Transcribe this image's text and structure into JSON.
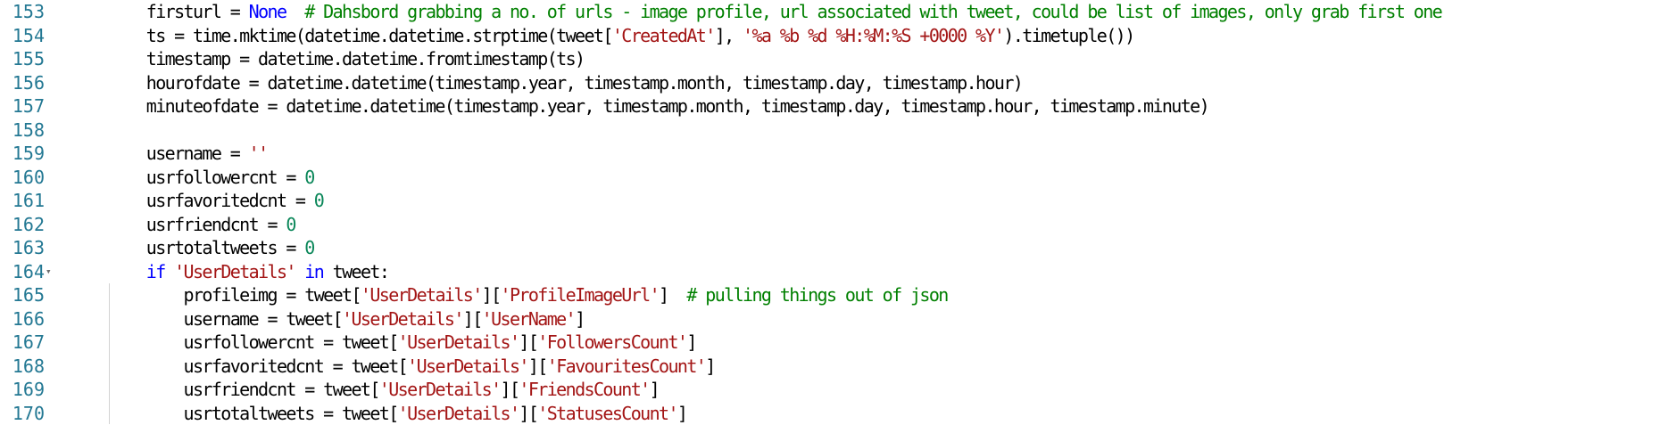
{
  "lines": [
    {
      "num": "153",
      "tokens": [
        {
          "t": "    firsturl = ",
          "c": ""
        },
        {
          "t": "None",
          "c": "kw"
        },
        {
          "t": "  # Dahsbord grabbing a no. of urls - image profile, url associated with tweet, could be list of images, only grab first one",
          "c": "com"
        }
      ]
    },
    {
      "num": "154",
      "tokens": [
        {
          "t": "    ts = time.mktime(datetime.datetime.strptime(tweet[",
          "c": ""
        },
        {
          "t": "'CreatedAt'",
          "c": "str"
        },
        {
          "t": "], ",
          "c": ""
        },
        {
          "t": "'%a %b %d %H:%M:%S +0000 %Y'",
          "c": "str"
        },
        {
          "t": ").timetuple())",
          "c": ""
        }
      ]
    },
    {
      "num": "155",
      "tokens": [
        {
          "t": "    timestamp = datetime.datetime.fromtimestamp(ts)",
          "c": ""
        }
      ]
    },
    {
      "num": "156",
      "tokens": [
        {
          "t": "    hourofdate = datetime.datetime(timestamp.year, timestamp.month, timestamp.day, timestamp.hour)",
          "c": ""
        }
      ]
    },
    {
      "num": "157",
      "tokens": [
        {
          "t": "    minuteofdate = datetime.datetime(timestamp.year, timestamp.month, timestamp.day, timestamp.hour, timestamp.minute)",
          "c": ""
        }
      ]
    },
    {
      "num": "158",
      "tokens": []
    },
    {
      "num": "159",
      "tokens": [
        {
          "t": "    username = ",
          "c": ""
        },
        {
          "t": "''",
          "c": "str"
        }
      ]
    },
    {
      "num": "160",
      "tokens": [
        {
          "t": "    usrfollowercnt = ",
          "c": ""
        },
        {
          "t": "0",
          "c": "num"
        }
      ]
    },
    {
      "num": "161",
      "tokens": [
        {
          "t": "    usrfavoritedcnt = ",
          "c": ""
        },
        {
          "t": "0",
          "c": "num"
        }
      ]
    },
    {
      "num": "162",
      "tokens": [
        {
          "t": "    usrfriendcnt = ",
          "c": ""
        },
        {
          "t": "0",
          "c": "num"
        }
      ]
    },
    {
      "num": "163",
      "tokens": [
        {
          "t": "    usrtotaltweets = ",
          "c": ""
        },
        {
          "t": "0",
          "c": "num"
        }
      ]
    },
    {
      "num": "164",
      "fold": true,
      "tokens": [
        {
          "t": "    ",
          "c": ""
        },
        {
          "t": "if",
          "c": "kw"
        },
        {
          "t": " ",
          "c": ""
        },
        {
          "t": "'UserDetails'",
          "c": "str"
        },
        {
          "t": " ",
          "c": ""
        },
        {
          "t": "in",
          "c": "kw"
        },
        {
          "t": " tweet:",
          "c": ""
        }
      ]
    },
    {
      "num": "165",
      "tokens": [
        {
          "t": "        profileimg = tweet[",
          "c": ""
        },
        {
          "t": "'UserDetails'",
          "c": "str"
        },
        {
          "t": "][",
          "c": ""
        },
        {
          "t": "'ProfileImageUrl'",
          "c": "str"
        },
        {
          "t": "]  ",
          "c": ""
        },
        {
          "t": "# pulling things out of json",
          "c": "com"
        }
      ]
    },
    {
      "num": "166",
      "tokens": [
        {
          "t": "        username = tweet[",
          "c": ""
        },
        {
          "t": "'UserDetails'",
          "c": "str"
        },
        {
          "t": "][",
          "c": ""
        },
        {
          "t": "'UserName'",
          "c": "str"
        },
        {
          "t": "]",
          "c": ""
        }
      ]
    },
    {
      "num": "167",
      "tokens": [
        {
          "t": "        usrfollowercnt = tweet[",
          "c": ""
        },
        {
          "t": "'UserDetails'",
          "c": "str"
        },
        {
          "t": "][",
          "c": ""
        },
        {
          "t": "'FollowersCount'",
          "c": "str"
        },
        {
          "t": "]",
          "c": ""
        }
      ]
    },
    {
      "num": "168",
      "tokens": [
        {
          "t": "        usrfavoritedcnt = tweet[",
          "c": ""
        },
        {
          "t": "'UserDetails'",
          "c": "str"
        },
        {
          "t": "][",
          "c": ""
        },
        {
          "t": "'FavouritesCount'",
          "c": "str"
        },
        {
          "t": "]",
          "c": ""
        }
      ]
    },
    {
      "num": "169",
      "tokens": [
        {
          "t": "        usrfriendcnt = tweet[",
          "c": ""
        },
        {
          "t": "'UserDetails'",
          "c": "str"
        },
        {
          "t": "][",
          "c": ""
        },
        {
          "t": "'FriendsCount'",
          "c": "str"
        },
        {
          "t": "]",
          "c": ""
        }
      ]
    },
    {
      "num": "170",
      "tokens": [
        {
          "t": "        usrtotaltweets = tweet[",
          "c": ""
        },
        {
          "t": "'UserDetails'",
          "c": "str"
        },
        {
          "t": "][",
          "c": ""
        },
        {
          "t": "'StatusesCount'",
          "c": "str"
        },
        {
          "t": "]",
          "c": ""
        }
      ]
    }
  ],
  "colors": {
    "keyword": "#0000ff",
    "string": "#a31515",
    "number": "#098658",
    "comment": "#008000",
    "line_number": "#237893",
    "background": "#ffffff"
  }
}
